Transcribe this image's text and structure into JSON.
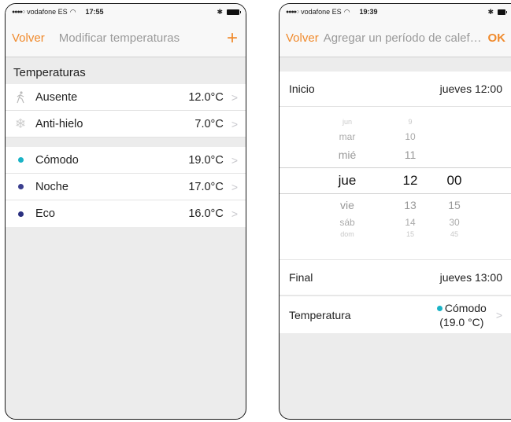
{
  "left": {
    "status": {
      "carrier": "vodafone ES",
      "signal": "●●●●○",
      "time": "17:55"
    },
    "nav": {
      "back": "Volver",
      "title": "Modificar temperaturas",
      "add": "+"
    },
    "section_title": "Temperaturas",
    "group1": [
      {
        "icon": "walking-person-icon",
        "label": "Ausente",
        "value": "12.0°C"
      },
      {
        "icon": "snowflake-icon",
        "label": "Anti-hielo",
        "value": "7.0°C"
      }
    ],
    "group2": [
      {
        "dot_color": "#1ab3c6",
        "label": "Cómodo",
        "value": "19.0°C"
      },
      {
        "dot_color": "#3b3f8f",
        "label": "Noche",
        "value": "17.0°C"
      },
      {
        "dot_color": "#2b3080",
        "label": "Eco",
        "value": "16.0°C"
      }
    ]
  },
  "right": {
    "status": {
      "carrier": "vodafone ES",
      "signal": "●●●●○",
      "time": "19:39"
    },
    "nav": {
      "back": "Volver",
      "title": "Agregar un período de calef…",
      "ok": "OK"
    },
    "start": {
      "label": "Inicio",
      "value": "jueves 12:00"
    },
    "picker": {
      "days": [
        "jun",
        "mar",
        "mié",
        "jue",
        "vie",
        "sáb",
        "dom"
      ],
      "hours": [
        "9",
        "10",
        "11",
        "12",
        "13",
        "14",
        "15"
      ],
      "minutes": [
        "",
        "",
        "",
        "00",
        "15",
        "30",
        "45"
      ]
    },
    "end": {
      "label": "Final",
      "value": "jueves 13:00"
    },
    "temperature": {
      "label": "Temperatura",
      "mode": "Cómodo",
      "value": "(19.0 °C)",
      "dot_color": "#1ab3c6"
    }
  },
  "colors": {
    "accent": "#f08a2c"
  }
}
